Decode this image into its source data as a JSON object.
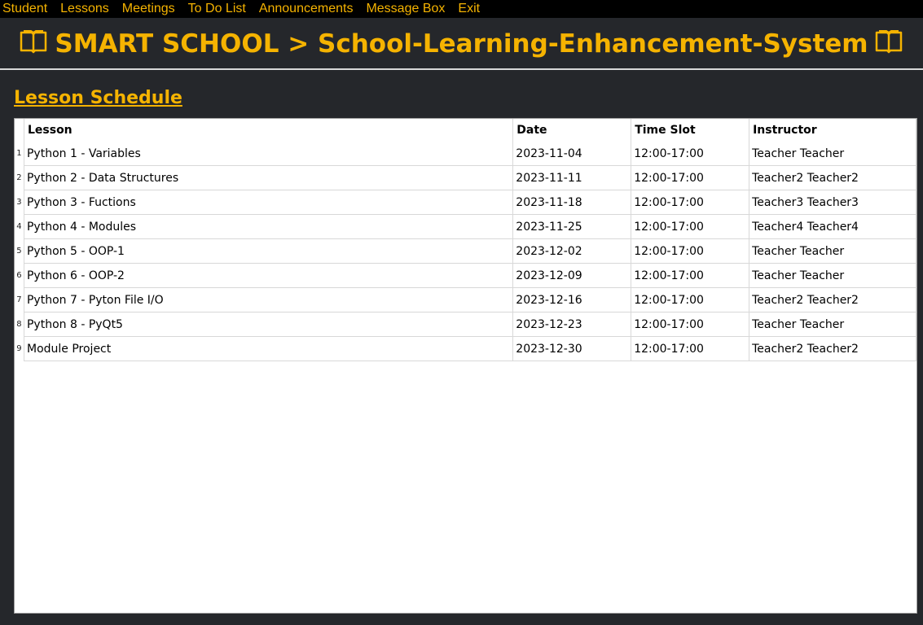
{
  "menu": {
    "items": [
      "Student",
      "Lessons",
      "Meetings",
      "To Do List",
      "Announcements",
      "Message Box",
      "Exit"
    ]
  },
  "header": {
    "title": "SMART SCHOOL > School-Learning-Enhancement-System",
    "left_icon": "book-icon",
    "right_icon": "book-icon"
  },
  "page": {
    "section_title": "Lesson Schedule"
  },
  "table": {
    "columns": [
      "Lesson",
      "Date",
      "Time Slot",
      "Instructor"
    ],
    "rows": [
      {
        "num": "1",
        "lesson": "Python 1 - Variables",
        "date": "2023-11-04",
        "slot": "12:00-17:00",
        "instructor": "Teacher Teacher"
      },
      {
        "num": "2",
        "lesson": "Python 2 - Data Structures",
        "date": "2023-11-11",
        "slot": "12:00-17:00",
        "instructor": "Teacher2 Teacher2"
      },
      {
        "num": "3",
        "lesson": "Python 3 - Fuctions",
        "date": "2023-11-18",
        "slot": "12:00-17:00",
        "instructor": "Teacher3 Teacher3"
      },
      {
        "num": "4",
        "lesson": "Python 4 - Modules",
        "date": "2023-11-25",
        "slot": "12:00-17:00",
        "instructor": "Teacher4 Teacher4"
      },
      {
        "num": "5",
        "lesson": "Python 5 - OOP-1",
        "date": "2023-12-02",
        "slot": "12:00-17:00",
        "instructor": "Teacher Teacher"
      },
      {
        "num": "6",
        "lesson": "Python 6 - OOP-2",
        "date": "2023-12-09",
        "slot": "12:00-17:00",
        "instructor": "Teacher Teacher"
      },
      {
        "num": "7",
        "lesson": "Python 7 - Pyton File I/O",
        "date": "2023-12-16",
        "slot": "12:00-17:00",
        "instructor": "Teacher2 Teacher2"
      },
      {
        "num": "8",
        "lesson": "Python 8 - PyQt5",
        "date": "2023-12-23",
        "slot": "12:00-17:00",
        "instructor": "Teacher Teacher"
      },
      {
        "num": "9",
        "lesson": "Module Project",
        "date": "2023-12-30",
        "slot": "12:00-17:00",
        "instructor": "Teacher2 Teacher2"
      }
    ]
  },
  "colors": {
    "accent": "#f5b301",
    "background": "#25272b",
    "menubar": "#000000"
  }
}
